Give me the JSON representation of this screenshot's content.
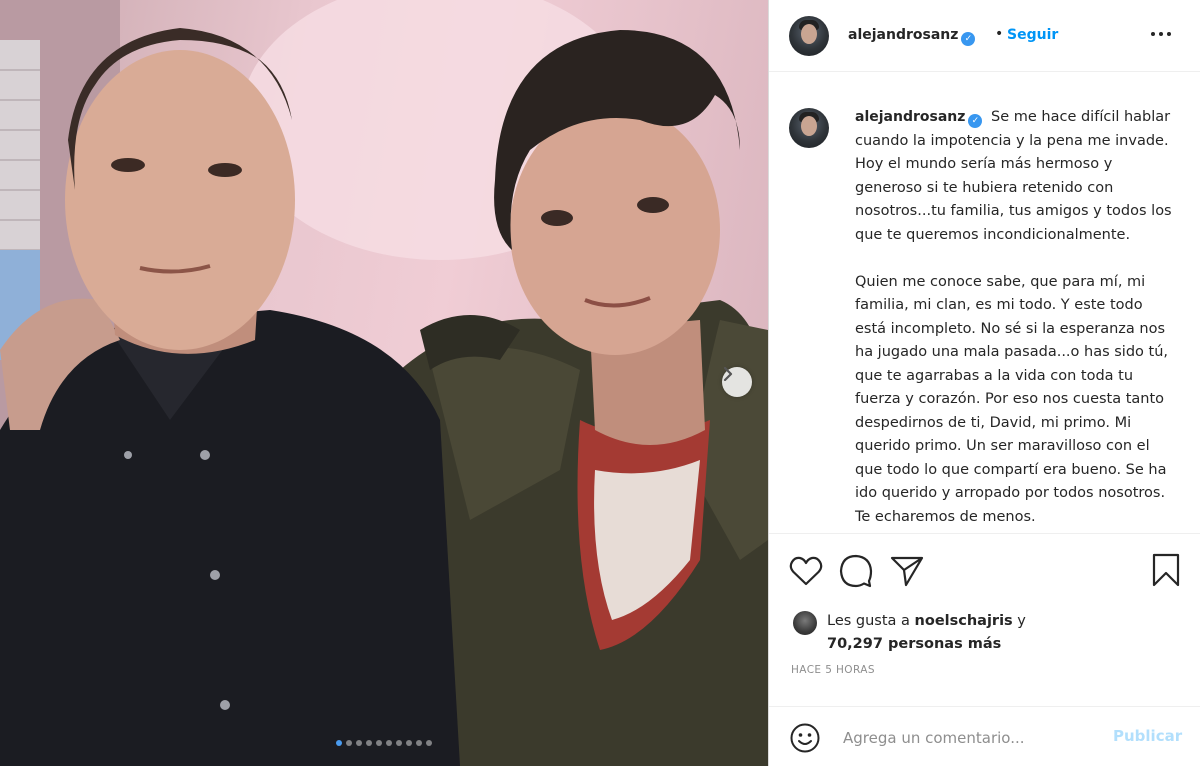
{
  "post": {
    "username": "alejandrosanz",
    "separator": "•",
    "follow_label": "Seguir",
    "more_label": "•••",
    "caption": {
      "paragraph1": "Se me hace difícil hablar cuando la impotencia y la pena me invade. Hoy el mundo sería más hermoso y generoso si te hubiera retenido con nosotros...tu familia, tus amigos y todos los que te queremos incondicionalmente.",
      "paragraph2": "Quien me conoce sabe, que para mí, mi familia, mi clan, es mi todo. Y este todo está incompleto. No sé si la esperanza nos ha jugado una mala pasada...o has sido tú, que te agarrabas a la vida con toda tu fuerza y corazón. Por eso nos cuesta tanto despedirnos de ti, David, mi primo. Mi querido primo. Un ser maravilloso con el que todo lo que compartí era bueno. Se ha ido querido y arropado por todos nosotros. Te echaremos de menos."
    },
    "likes": {
      "prefix": "Les gusta a ",
      "liker": "noelschajris",
      "conjunction": " y",
      "count_text": "70,297 personas más"
    },
    "time_label": "HACE 5 HORAS",
    "comment": {
      "placeholder": "Agrega un comentario...",
      "publish_label": "Publicar"
    }
  },
  "carousel": {
    "total_slides": 10,
    "active_slide": 1
  },
  "icons": {
    "verified": "verified-badge-icon",
    "more": "more-options-icon",
    "like": "heart-icon",
    "comment": "comment-bubble-icon",
    "share": "paper-plane-icon",
    "save": "bookmark-icon",
    "emoji": "smiley-icon",
    "next": "chevron-right-icon"
  },
  "colors": {
    "link_blue": "#0095f6",
    "verified_blue": "#3897f0",
    "publish_disabled": "#b2dffc",
    "secondary_text": "#8e8e8e",
    "dot_active": "#4a9bf0"
  }
}
